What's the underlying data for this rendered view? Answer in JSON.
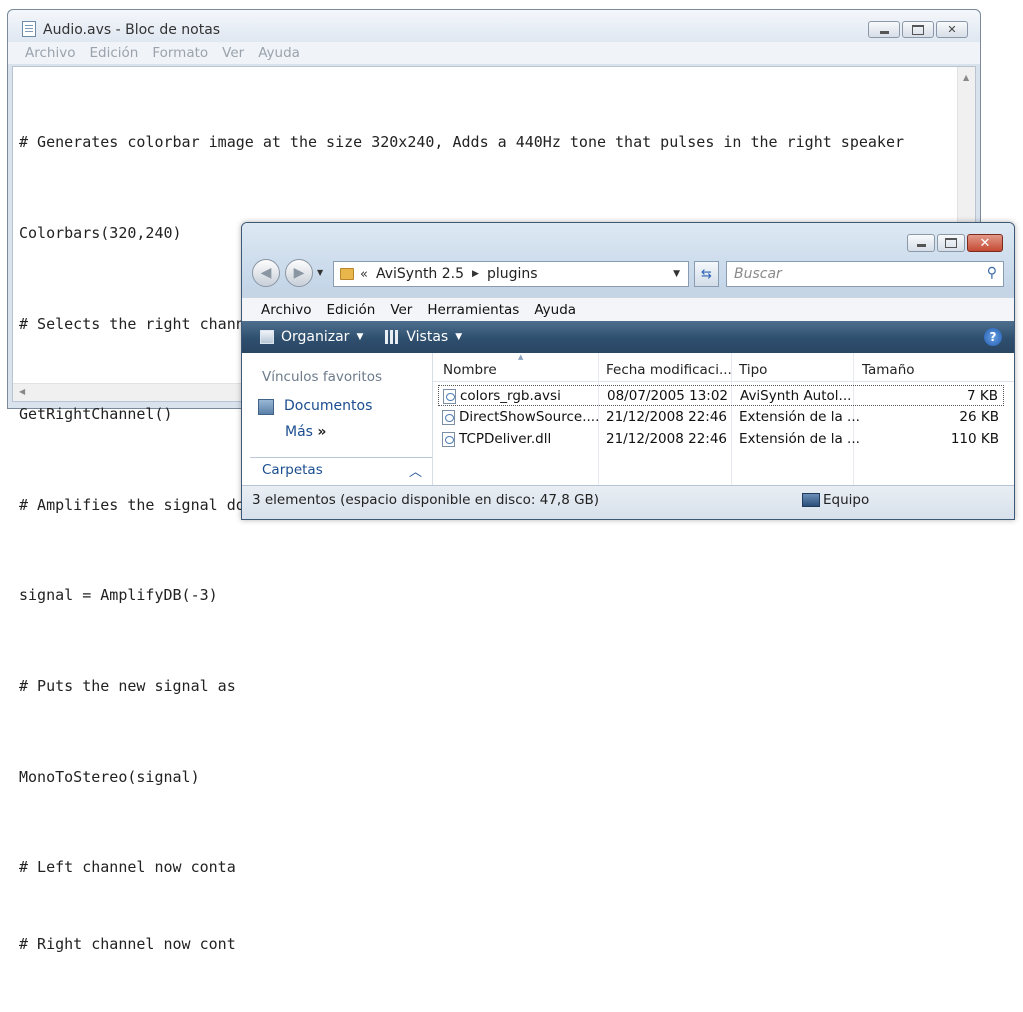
{
  "notepad": {
    "title": "Audio.avs - Bloc de notas",
    "menu": [
      "Archivo",
      "Edición",
      "Formato",
      "Ver",
      "Ayuda"
    ],
    "lines": [
      "# Generates colorbar image at the size 320x240, Adds a 440Hz tone that pulses in the right speaker",
      "Colorbars(320,240)",
      "# Selects the right channel",
      "GetRightChannel()",
      "# Amplifies the signal down 3DB, and puts the result into the variable 'signal'",
      "signal = AmplifyDB(-3)",
      "# Puts the new signal as",
      "MonoToStereo(signal)",
      "# Left channel now conta",
      "# Right channel now cont"
    ]
  },
  "explorer": {
    "address": {
      "prefix": "«",
      "segments": [
        "AviSynth 2.5",
        "plugins"
      ]
    },
    "search_placeholder": "Buscar",
    "menu": [
      "Archivo",
      "Edición",
      "Ver",
      "Herramientas",
      "Ayuda"
    ],
    "toolbar": {
      "organize": "Organizar",
      "views": "Vistas"
    },
    "left_pane": {
      "favorites_heading": "Vínculos favoritos",
      "documents": "Documentos",
      "more": "Más",
      "more_arrows": "»",
      "folders": "Carpetas"
    },
    "columns": [
      "Nombre",
      "Fecha modificaci...",
      "Tipo",
      "Tamaño"
    ],
    "files": [
      {
        "name": "colors_rgb.avsi",
        "date": "08/07/2005 13:02",
        "type": "AviSynth Autol...",
        "size": "7 KB"
      },
      {
        "name": "DirectShowSource....",
        "date": "21/12/2008 22:46",
        "type": "Extensión de la ...",
        "size": "26 KB"
      },
      {
        "name": "TCPDeliver.dll",
        "date": "21/12/2008 22:46",
        "type": "Extensión de la ...",
        "size": "110 KB"
      }
    ],
    "status": "3 elementos (espacio disponible en disco: 47,8 GB)",
    "status_right": "Equipo"
  }
}
